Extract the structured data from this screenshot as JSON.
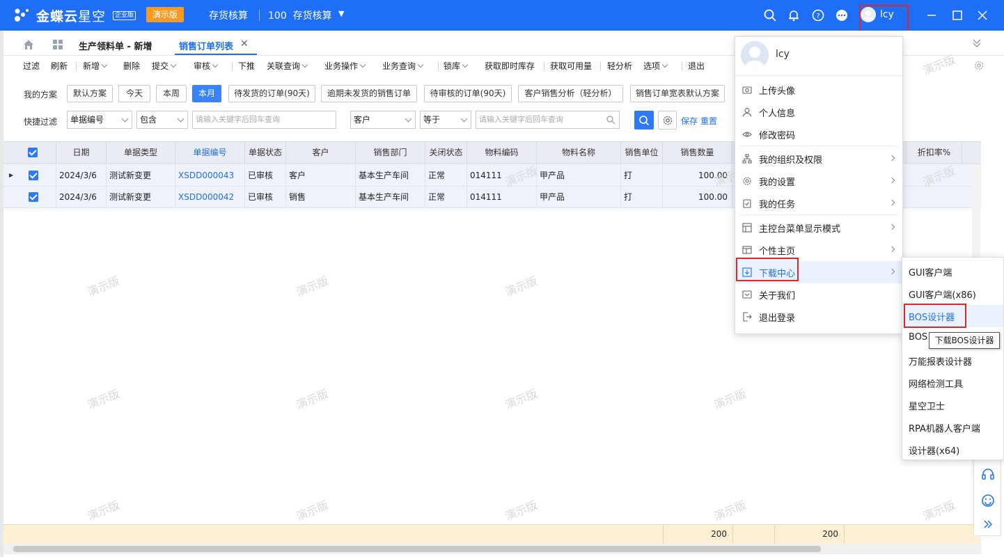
{
  "app": {
    "brand_main": "金蝶云",
    "brand_sub": "星空",
    "edition": "企业版",
    "demo_label": "演示版",
    "module_title": "存货核算",
    "org_code": "100",
    "org_name": "存货核算",
    "user_name": "lcy"
  },
  "tabs": [
    {
      "label": "生产领料单 - 新增"
    },
    {
      "label": "销售订单列表",
      "active": true
    }
  ],
  "toolbar": [
    "过滤",
    "刷新",
    "新增",
    "删除",
    "提交",
    "审核",
    "下推",
    "关联查询",
    "业务操作",
    "业务查询",
    "锁库",
    "获取即时库存",
    "获取可用量",
    "轻分析",
    "选项",
    "退出"
  ],
  "scheme": {
    "label": "我的方案",
    "buttons": [
      "默认方案",
      "今天",
      "本周",
      "本月",
      "待发货的订单(90天)",
      "逾期未发货的销售订单",
      "待审核的订单(90天)",
      "客户销售分析（轻分析）",
      "销售订单宽表默认方案"
    ],
    "active_index": 3
  },
  "quick_filter": {
    "label": "快捷过滤",
    "field1": "单据编号",
    "op1": "包含",
    "placeholder1": "请输入关键字后回车查询",
    "field2": "客户",
    "op2": "等于",
    "placeholder2": "请输入关键字后回车查询",
    "save": "保存",
    "reset": "重置"
  },
  "grid": {
    "columns": [
      "日期",
      "单据类型",
      "单据编号",
      "单据状态",
      "客户",
      "销售部门",
      "关闭状态",
      "物料编码",
      "物料名称",
      "销售单位",
      "销售数量",
      "",
      "",
      "",
      "折扣率%"
    ],
    "rows": [
      {
        "date": "2024/3/6",
        "type": "测试新变更",
        "no": "XSDD000043",
        "status": "已审核",
        "customer": "客户",
        "dept": "基本生产车间",
        "close": "正常",
        "mcode": "014111",
        "mname": "甲产品",
        "unit": "打",
        "qty": "100.00"
      },
      {
        "date": "2024/3/6",
        "type": "测试新变更",
        "no": "XSDD000042",
        "status": "已审核",
        "customer": "销售",
        "dept": "基本生产车间",
        "close": "正常",
        "mcode": "014111",
        "mname": "甲产品",
        "unit": "打",
        "qty": "100.00"
      }
    ],
    "sum_qty": "200",
    "sum_other": "200"
  },
  "user_menu": {
    "name": "lcy",
    "groups": [
      [
        {
          "label": "上传头像",
          "icon": "camera-icon"
        },
        {
          "label": "个人信息",
          "icon": "person-icon"
        },
        {
          "label": "修改密码",
          "icon": "eye-icon"
        }
      ],
      [
        {
          "label": "我的组织及权限",
          "icon": "org-icon",
          "arrow": true
        },
        {
          "label": "我的设置",
          "icon": "gear-icon",
          "arrow": true
        },
        {
          "label": "我的任务",
          "icon": "task-icon",
          "arrow": true
        }
      ],
      [
        {
          "label": "主控台菜单显示模式",
          "icon": "menu-mode-icon",
          "arrow": true
        },
        {
          "label": "个性主页",
          "icon": "homepage-icon",
          "arrow": true
        },
        {
          "label": "下载中心",
          "icon": "download-icon",
          "arrow": true,
          "highlight": true
        },
        {
          "label": "关于我们",
          "icon": "info-icon"
        },
        {
          "label": "退出登录",
          "icon": "logout-icon"
        }
      ]
    ]
  },
  "download_submenu": [
    "GUI客户端",
    "GUI客户端(x86)",
    "BOS设计器",
    "BOS",
    "万能报表设计器",
    "网络检测工具",
    "星空卫士",
    "RPA机器人客户端",
    "设计器(x64)"
  ],
  "tooltip": "下载BOS设计器",
  "colors": {
    "primary": "#1f6ff6",
    "demo_badge": "#f59a23",
    "highlight_box": "#e02828",
    "sum_bar": "#fdf0d5"
  }
}
